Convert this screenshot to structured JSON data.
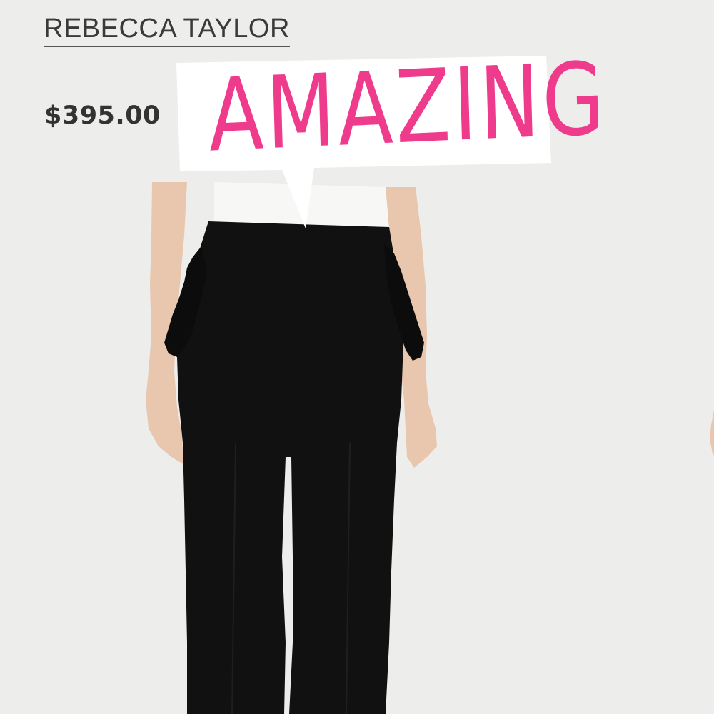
{
  "product": {
    "brand": "REBECCA TAYLOR",
    "price": "$395.00"
  },
  "sticker": {
    "text": "AMAZING",
    "color": "#ee3b8b"
  },
  "image": {
    "subject": "model-wearing-black-ruffle-trousers"
  },
  "colors": {
    "background": "#ededeb",
    "garment": "#111111",
    "text": "#333333"
  }
}
